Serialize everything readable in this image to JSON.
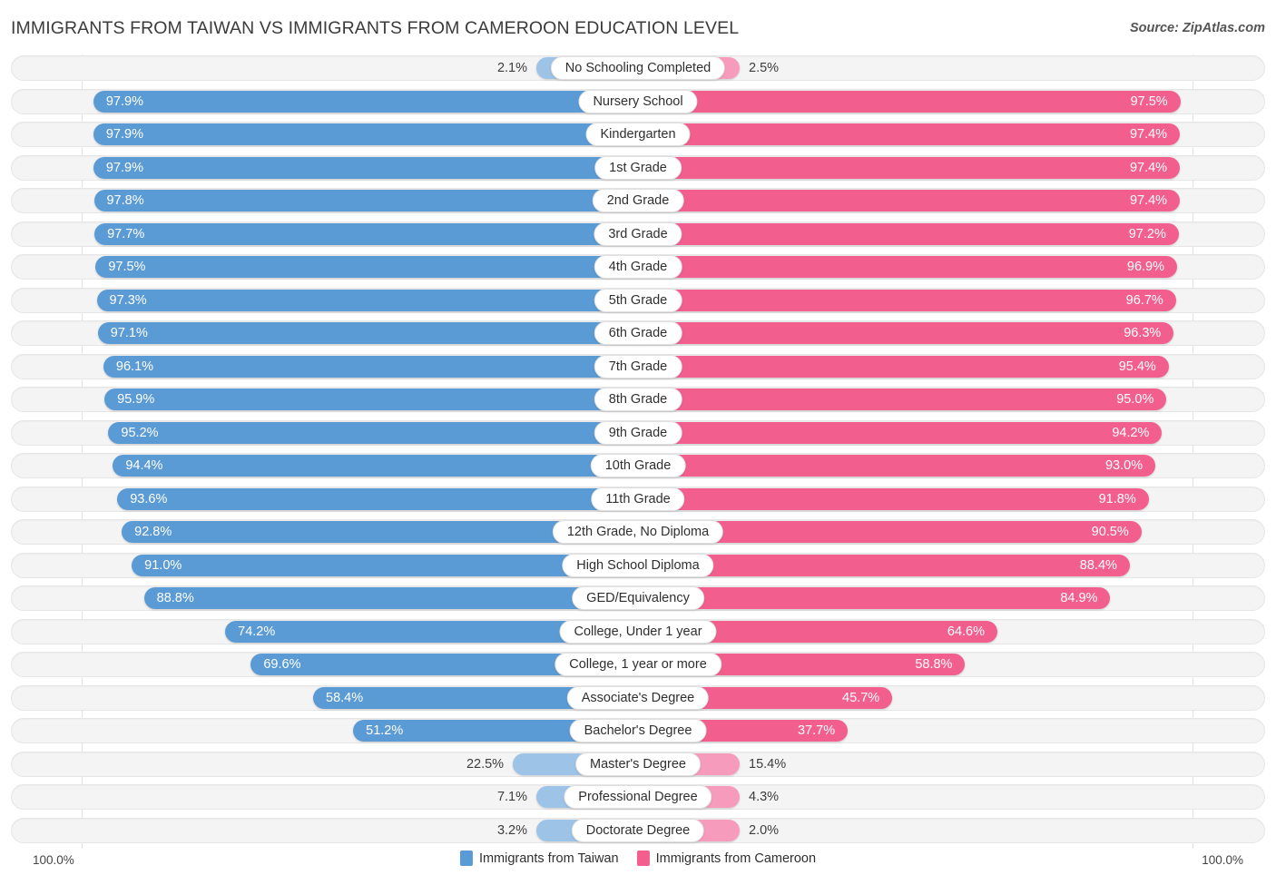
{
  "header": {
    "title": "IMMIGRANTS FROM TAIWAN VS IMMIGRANTS FROM CAMEROON EDUCATION LEVEL",
    "source": "Source: ZipAtlas.com"
  },
  "footer": {
    "axis_min_left": "100.0%",
    "axis_min_right": "100.0%",
    "legend": [
      {
        "label": "Immigrants from Taiwan",
        "color": "#5b9bd5",
        "swatch": "blue"
      },
      {
        "label": "Immigrants from Cameroon",
        "color": "#f25f8e",
        "swatch": "pink"
      }
    ]
  },
  "colors": {
    "left_bar": "#5b9bd5",
    "left_bar_pale": "#9dc3e6",
    "right_bar": "#f25f8e",
    "right_bar_pale": "#f79bbd",
    "track": "#f4f4f4",
    "label_pill": "#ffffff"
  },
  "chart_data": {
    "type": "bar",
    "title": "IMMIGRANTS FROM TAIWAN VS IMMIGRANTS FROM CAMEROON EDUCATION LEVEL",
    "subtitle": "",
    "xlabel": "",
    "ylabel": "",
    "orientation": "horizontal-diverging",
    "xlim": [
      0,
      100
    ],
    "grid": false,
    "legend_position": "bottom-center",
    "categories": [
      "No Schooling Completed",
      "Nursery School",
      "Kindergarten",
      "1st Grade",
      "2nd Grade",
      "3rd Grade",
      "4th Grade",
      "5th Grade",
      "6th Grade",
      "7th Grade",
      "8th Grade",
      "9th Grade",
      "10th Grade",
      "11th Grade",
      "12th Grade, No Diploma",
      "High School Diploma",
      "GED/Equivalency",
      "College, Under 1 year",
      "College, 1 year or more",
      "Associate's Degree",
      "Bachelor's Degree",
      "Master's Degree",
      "Professional Degree",
      "Doctorate Degree"
    ],
    "series": [
      {
        "name": "Immigrants from Taiwan",
        "side": "left",
        "values": [
          2.1,
          97.9,
          97.9,
          97.9,
          97.8,
          97.7,
          97.5,
          97.3,
          97.1,
          96.1,
          95.9,
          95.2,
          94.4,
          93.6,
          92.8,
          91.0,
          88.8,
          74.2,
          69.6,
          58.4,
          51.2,
          22.5,
          7.1,
          3.2
        ],
        "labels": [
          "2.1%",
          "97.9%",
          "97.9%",
          "97.9%",
          "97.8%",
          "97.7%",
          "97.5%",
          "97.3%",
          "97.1%",
          "96.1%",
          "95.9%",
          "95.2%",
          "94.4%",
          "93.6%",
          "92.8%",
          "91.0%",
          "88.8%",
          "74.2%",
          "69.6%",
          "58.4%",
          "51.2%",
          "22.5%",
          "7.1%",
          "3.2%"
        ]
      },
      {
        "name": "Immigrants from Cameroon",
        "side": "right",
        "values": [
          2.5,
          97.5,
          97.4,
          97.4,
          97.4,
          97.2,
          96.9,
          96.7,
          96.3,
          95.4,
          95.0,
          94.2,
          93.0,
          91.8,
          90.5,
          88.4,
          84.9,
          64.6,
          58.8,
          45.7,
          37.7,
          15.4,
          4.3,
          2.0
        ],
        "labels": [
          "2.5%",
          "97.5%",
          "97.4%",
          "97.4%",
          "97.4%",
          "97.2%",
          "96.9%",
          "96.7%",
          "96.3%",
          "95.4%",
          "95.0%",
          "94.2%",
          "93.0%",
          "91.8%",
          "90.5%",
          "88.4%",
          "84.9%",
          "64.6%",
          "58.8%",
          "45.7%",
          "37.7%",
          "15.4%",
          "4.3%",
          "2.0%"
        ]
      }
    ]
  }
}
